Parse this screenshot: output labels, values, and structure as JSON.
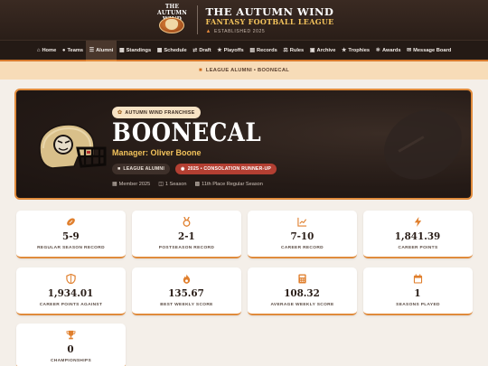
{
  "header": {
    "logo_text": "THE AUTUMN WIND",
    "title": "THE AUTUMN WIND",
    "subtitle": "FANTASY FOOTBALL LEAGUE",
    "established": "ESTABLISHED 2025"
  },
  "nav": {
    "items": [
      {
        "label": "Home",
        "icon": "home-icon"
      },
      {
        "label": "Teams",
        "icon": "users-icon"
      },
      {
        "label": "Alumni",
        "icon": "list-icon",
        "active": true
      },
      {
        "label": "Standings",
        "icon": "podium-icon"
      },
      {
        "label": "Schedule",
        "icon": "calendar-icon"
      },
      {
        "label": "Draft",
        "icon": "draft-icon"
      },
      {
        "label": "Playoffs",
        "icon": "trophy-icon"
      },
      {
        "label": "Records",
        "icon": "chart-icon"
      },
      {
        "label": "Rules",
        "icon": "scale-icon"
      },
      {
        "label": "Archive",
        "icon": "archive-icon"
      },
      {
        "label": "Trophies",
        "icon": "trophy-icon"
      },
      {
        "label": "Awards",
        "icon": "award-icon"
      },
      {
        "label": "Message Board",
        "icon": "chat-icon"
      }
    ]
  },
  "breadcrumb": "LEAGUE ALUMNI • BOONECAL",
  "hero": {
    "franchise_badge": "AUTUMN WIND FRANCHISE",
    "team_name": "BOONECAL",
    "manager": "Manager: Oliver Boone",
    "chip_alumni": "LEAGUE ALUMNI",
    "chip_result": "2025 • CONSOLATION RUNNER-UP",
    "member_since": "Member 2025",
    "seasons": "1 Season",
    "finish": "11th Place Regular Season"
  },
  "stats": [
    {
      "value": "5-9",
      "label": "REGULAR SEASON RECORD",
      "icon": "football-icon"
    },
    {
      "value": "2-1",
      "label": "POSTSEASON RECORD",
      "icon": "medal-icon"
    },
    {
      "value": "7-10",
      "label": "CAREER RECORD",
      "icon": "line-chart-icon"
    },
    {
      "value": "1,841.39",
      "label": "CAREER POINTS",
      "icon": "bolt-icon"
    },
    {
      "value": "1,934.01",
      "label": "CAREER POINTS AGAINST",
      "icon": "shield-icon"
    },
    {
      "value": "135.67",
      "label": "BEST WEEKLY SCORE",
      "icon": "flame-icon"
    },
    {
      "value": "108.32",
      "label": "AVERAGE WEEKLY SCORE",
      "icon": "calculator-icon"
    },
    {
      "value": "1",
      "label": "SEASONS PLAYED",
      "icon": "calendar-icon"
    },
    {
      "value": "0",
      "label": "CHAMPIONSHIPS",
      "icon": "trophy-icon"
    }
  ],
  "colors": {
    "accent": "#e08b3c",
    "dark": "#241a15",
    "gold": "#f2c25b",
    "result_chip": "#b33f32"
  }
}
